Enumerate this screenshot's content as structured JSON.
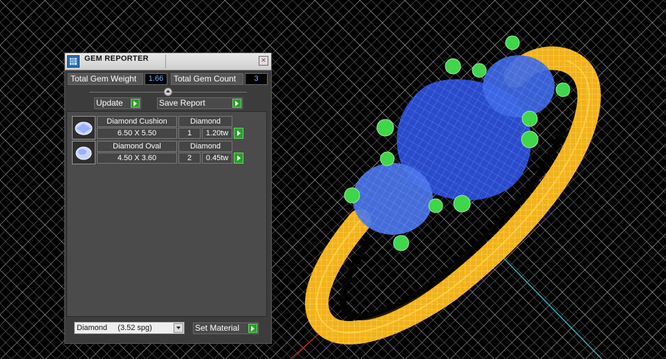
{
  "panel": {
    "title": "GEM REPORTER",
    "total_weight_label": "Total Gem Weight",
    "total_weight_value": "1.66",
    "total_count_label": "Total Gem Count",
    "total_count_value": "3",
    "update_label": "Update",
    "save_report_label": "Save Report",
    "gems": [
      {
        "name": "Diamond Cushion",
        "material": "Diamond",
        "size": "6.50 X 5.50",
        "count": "1",
        "weight": "1.20tw"
      },
      {
        "name": "Diamond Oval",
        "material": "Diamond",
        "size": "4.50 X 3.60",
        "count": "2",
        "weight": "0.45tw"
      }
    ],
    "material_selected": "Diamond     (3.52 spg)",
    "set_material_label": "Set Material"
  },
  "colors": {
    "viewport_bg": "#000000",
    "grid": "#d9d9d9",
    "ring_metal": "#f2b21a",
    "gem_blue": "#2b4fd6",
    "prongs": "#3fd64a",
    "accent_green": "#2f9a2f"
  }
}
